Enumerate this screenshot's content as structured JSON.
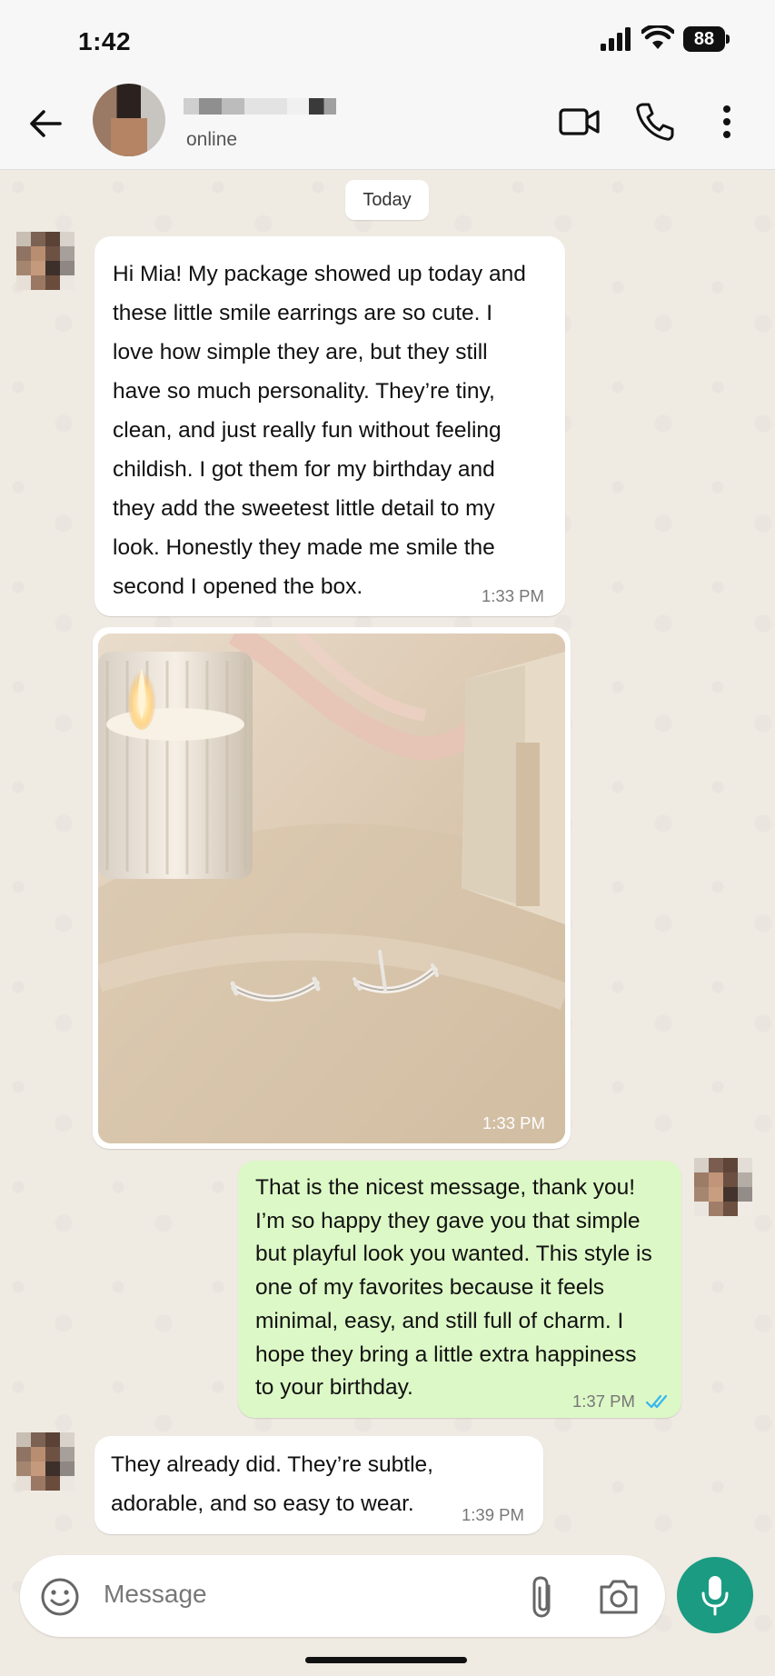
{
  "status_bar": {
    "time": "1:42",
    "battery": "88"
  },
  "header": {
    "status": "online"
  },
  "date_divider": "Today",
  "messages": [
    {
      "direction": "in",
      "text": "Hi Mia! My package showed up today and\nthese little smile earrings are so cute. I\nlove how simple they are, but they still\nhave so much personality. They’re tiny,\nclean, and just really fun without feeling\nchildish. I got them for my birthday and\nthey add the sweetest little detail to my\nlook. Honestly they made me smile the\nsecond I opened the box.",
      "time": "1:33 PM"
    },
    {
      "direction": "in",
      "type": "image",
      "time": "1:33 PM"
    },
    {
      "direction": "out",
      "text": "That is the nicest message, thank you!\nI’m so happy they gave you that simple\nbut playful look you wanted. This style is\none of my favorites because it feels\nminimal, easy, and still full of charm. I\nhope they bring a little extra happiness\nto your birthday.",
      "time": "1:37 PM",
      "read": true
    },
    {
      "direction": "in",
      "text": "They already did. They’re subtle,\nadorable, and so easy to wear.",
      "time": "1:39 PM"
    }
  ],
  "composer": {
    "placeholder": "Message"
  },
  "colors": {
    "accent": "#1a9b82",
    "outgoing_bubble": "#dcf8c6",
    "read_ticks": "#34b7f1"
  }
}
